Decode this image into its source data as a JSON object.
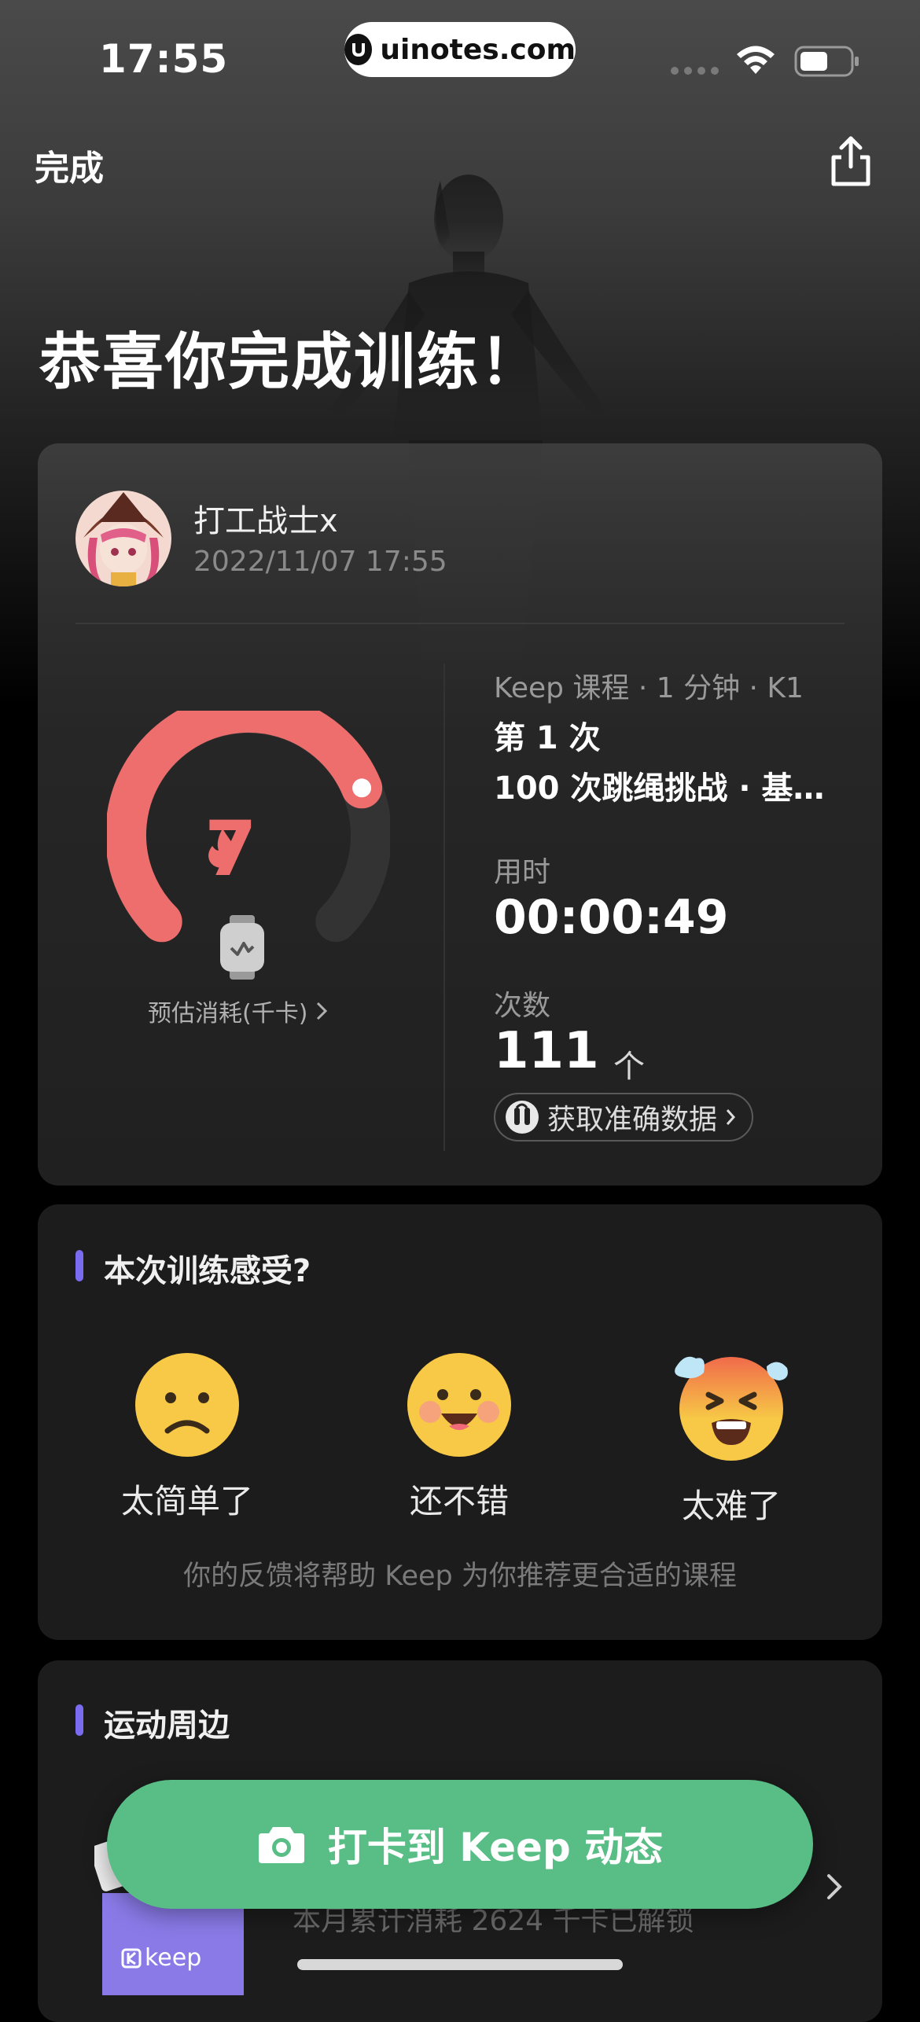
{
  "status_bar": {
    "time": "17:55",
    "watermark": "uinotes.com"
  },
  "header": {
    "done_label": "完成",
    "congrats_title": "恭喜你完成训练！"
  },
  "summary": {
    "username": "打工战士x",
    "datetime": "2022/11/07 17:55",
    "calories_value": "7",
    "calories_label": "预估消耗(千卡)",
    "calories_progress": 0.75,
    "course_meta": "Keep 课程 · 1 分钟 · K1",
    "course_count": "第 1 次",
    "course_name": "100 次跳绳挑战 · 基…",
    "duration_label": "用时",
    "duration_value": "00:00:49",
    "count_label": "次数",
    "count_value": "111",
    "count_unit": "个",
    "accurate_button": "获取准确数据"
  },
  "feedback": {
    "title": "本次训练感受?",
    "options": [
      {
        "label": "太简单了",
        "icon": "frown-emoji-icon"
      },
      {
        "label": "还不错",
        "icon": "smile-emoji-icon"
      },
      {
        "label": "太难了",
        "icon": "exhausted-emoji-icon"
      }
    ],
    "hint": "你的反馈将帮助 Keep 为你推荐更合适的课程"
  },
  "merch": {
    "title": "运动周边",
    "text": "本月累计消耗 2624 千卡已解锁",
    "badge": "keep"
  },
  "checkin_button": "打卡到 Keep 动态",
  "colors": {
    "accent": "#58be86",
    "gauge": "#ee6d6d",
    "section_bar": "#7a6bf0"
  }
}
